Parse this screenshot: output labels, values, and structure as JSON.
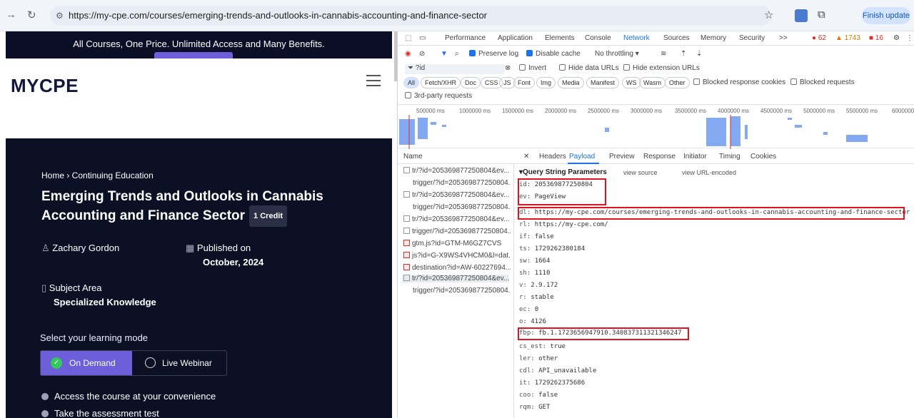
{
  "browser": {
    "url": "https://my-cpe.com/courses/emerging-trends-and-outlooks-in-cannabis-accounting-and-finance-sector",
    "update_button": "Finish update"
  },
  "site": {
    "promo_text": "All Courses, One Price. Unlimited Access and Many Benefits.",
    "logo": "MYCPE",
    "breadcrumb": "Home › Continuing Education",
    "course_title": "Emerging Trends and Outlooks in Cannabis Accounting and Finance Sector",
    "credit_badge": "1 Credit",
    "instructor": "Zachary Gordon",
    "published_label": "Published on",
    "published_date": "October, 2024",
    "subject_label": "Subject Area",
    "subject_value": "Specialized Knowledge",
    "mode_heading": "Select your learning mode",
    "mode_on_demand": "On Demand",
    "mode_live": "Live Webinar",
    "bullets": [
      "Access the course at your convenience",
      "Take the assessment test"
    ]
  },
  "devtools": {
    "tabs": [
      "Performance",
      "Application",
      "Elements",
      "Console",
      "Network",
      "Sources",
      "Memory",
      "Security",
      ">>"
    ],
    "active_tab": "Network",
    "counters": {
      "errors": "62",
      "warnings": "1743",
      "issues": "16"
    },
    "toolbar": {
      "preserve_log": "Preserve log",
      "disable_cache": "Disable cache",
      "throttling": "No throttling"
    },
    "filter_value": "?id",
    "filter_options": [
      "Invert",
      "Hide data URLs",
      "Hide extension URLs"
    ],
    "type_chips": [
      "All",
      "Fetch/XHR",
      "Doc",
      "CSS",
      "JS",
      "Font",
      "Img",
      "Media",
      "Manifest",
      "WS",
      "Wasm",
      "Other"
    ],
    "blocked_options": [
      "Blocked response cookies",
      "Blocked requests"
    ],
    "third_party": "3rd-party requests",
    "timeline_ticks": [
      "500000 ms",
      "1000000 ms",
      "1500000 ms",
      "2000000 ms",
      "2500000 ms",
      "3000000 ms",
      "3500000 ms",
      "4000000 ms",
      "4500000 ms",
      "5000000 ms",
      "5500000 ms",
      "6000000"
    ],
    "name_header": "Name",
    "requests": [
      "tr/?id=205369877250804&ev...",
      "trigger/?id=205369877250804...",
      "tr/?id=205369877250804&ev...",
      "trigger/?id=205369877250804...",
      "tr/?id=205369877250804&ev...",
      "trigger/?id=205369877250804...",
      "gtm.js?id=GTM-M6GZ7CVS",
      "js?id=G-X9WS4VHCM0&l=dat...",
      "destination?id=AW-60227694...",
      "tr/?id=205369877250804&ev...",
      "trigger/?id=205369877250804..."
    ],
    "panel_tabs": [
      "Headers",
      "Payload",
      "Preview",
      "Response",
      "Initiator",
      "Timing",
      "Cookies"
    ],
    "active_panel_tab": "Payload",
    "section_title": "▾Query String Parameters",
    "view_source": "view source",
    "view_url_encoded": "view URL-encoded",
    "params": [
      {
        "k": "id:",
        "v": "205369877250804"
      },
      {
        "k": "ev:",
        "v": "PageView"
      },
      {
        "k": "dl:",
        "v": "https://my-cpe.com/courses/emerging-trends-and-outlooks-in-cannabis-accounting-and-finance-sector"
      },
      {
        "k": "rl:",
        "v": "https://my-cpe.com/"
      },
      {
        "k": "if:",
        "v": "false"
      },
      {
        "k": "ts:",
        "v": "1729262380184"
      },
      {
        "k": "sw:",
        "v": "1664"
      },
      {
        "k": "sh:",
        "v": "1110"
      },
      {
        "k": "v:",
        "v": "2.9.172"
      },
      {
        "k": "r:",
        "v": "stable"
      },
      {
        "k": "ec:",
        "v": "0"
      },
      {
        "k": "o:",
        "v": "4126"
      },
      {
        "k": "fbp:",
        "v": "fb.1.1723656947910.340837311321346247"
      },
      {
        "k": "cs_est:",
        "v": "true"
      },
      {
        "k": "ler:",
        "v": "other"
      },
      {
        "k": "cdl:",
        "v": "API_unavailable"
      },
      {
        "k": "it:",
        "v": "1729262375686"
      },
      {
        "k": "coo:",
        "v": "false"
      },
      {
        "k": "rqm:",
        "v": "GET"
      }
    ]
  }
}
